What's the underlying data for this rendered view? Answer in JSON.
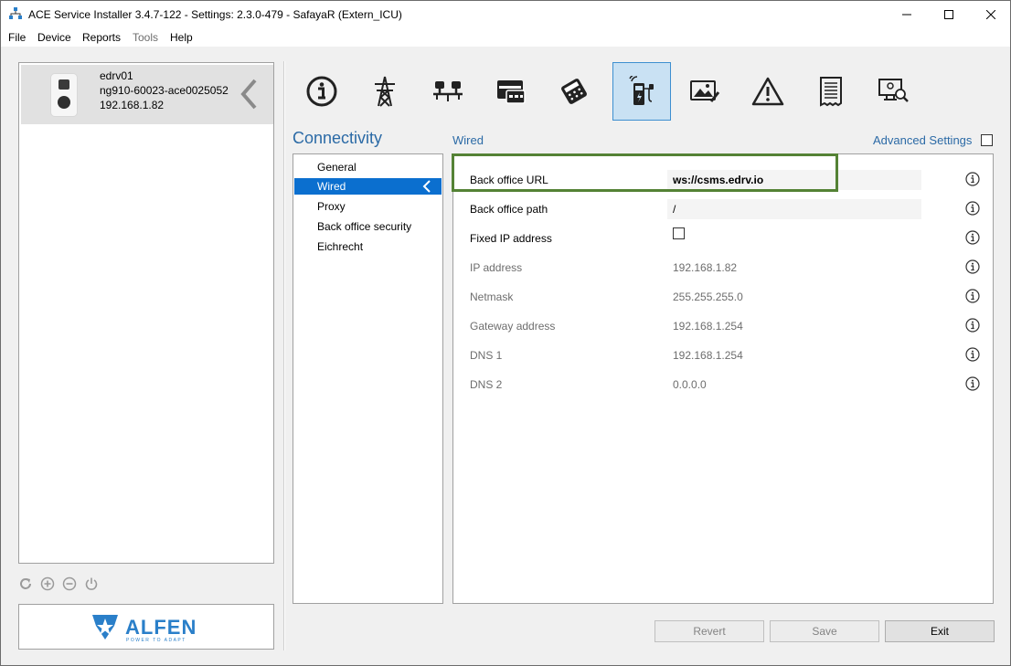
{
  "window": {
    "title": "ACE Service Installer 3.4.7-122 - Settings: 2.3.0-479 - SafayaR (Extern_ICU)",
    "controls": [
      "minimize-icon",
      "maximize-icon",
      "close-icon"
    ]
  },
  "menu": {
    "file": "File",
    "device": "Device",
    "reports": "Reports",
    "tools": "Tools",
    "help": "Help"
  },
  "device": {
    "name": "edrv01",
    "serial": "ng910-60023-ace0025052",
    "ip": "192.168.1.82"
  },
  "device_tools": [
    "refresh-icon",
    "add-icon",
    "remove-icon",
    "power-icon"
  ],
  "logo": {
    "name": "ALFEN",
    "tagline": "POWER TO ADAPT"
  },
  "categories": [
    {
      "icon": "info-icon",
      "active": false
    },
    {
      "icon": "power-tower-icon",
      "active": false
    },
    {
      "icon": "balance-icon",
      "active": false
    },
    {
      "icon": "card-reader-icon",
      "active": false
    },
    {
      "icon": "payment-terminal-icon",
      "active": false
    },
    {
      "icon": "connectivity-charger-icon",
      "active": true
    },
    {
      "icon": "display-image-icon",
      "active": false
    },
    {
      "icon": "warning-icon",
      "active": false
    },
    {
      "icon": "document-icon",
      "active": false
    },
    {
      "icon": "diagnostics-icon",
      "active": false
    }
  ],
  "section": {
    "title": "Connectivity",
    "subtitle": "Wired",
    "advanced_label": "Advanced Settings",
    "advanced_checked": false
  },
  "subnav": {
    "items": [
      "General",
      "Wired",
      "Proxy",
      "Back office security",
      "Eichrecht"
    ],
    "selected": "Wired"
  },
  "settings": {
    "back_office_url_label": "Back office URL",
    "back_office_url": "ws://csms.edrv.io",
    "back_office_path_label": "Back office path",
    "back_office_path": "/",
    "fixed_ip_label": "Fixed IP address",
    "fixed_ip_checked": false,
    "ip_label": "IP address",
    "ip": "192.168.1.82",
    "netmask_label": "Netmask",
    "netmask": "255.255.255.0",
    "gateway_label": "Gateway address",
    "gateway": "192.168.1.254",
    "dns1_label": "DNS 1",
    "dns1": "192.168.1.254",
    "dns2_label": "DNS 2",
    "dns2": "0.0.0.0"
  },
  "buttons": {
    "revert": "Revert",
    "save": "Save",
    "exit": "Exit"
  },
  "colors": {
    "accent": "#2b6aa6",
    "selection": "#0b6fcf",
    "highlight_border": "#548235"
  }
}
